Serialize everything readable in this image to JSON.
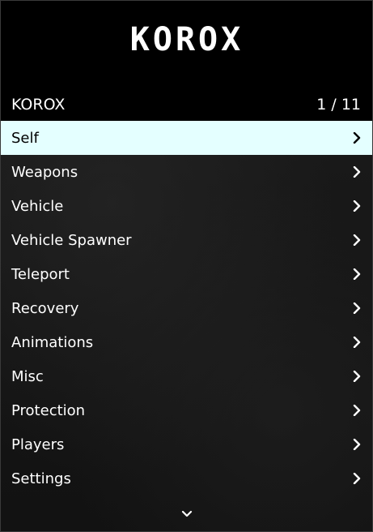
{
  "header": {
    "logo_text": "KOROX"
  },
  "subheader": {
    "title": "KOROX",
    "page_indicator": "1 / 11"
  },
  "menu": {
    "selected_index": 0,
    "items": [
      {
        "label": "Self",
        "icon": "chevron-right-icon"
      },
      {
        "label": "Weapons",
        "icon": "chevron-right-icon"
      },
      {
        "label": "Vehicle",
        "icon": "chevron-right-icon"
      },
      {
        "label": "Vehicle Spawner",
        "icon": "chevron-right-icon"
      },
      {
        "label": "Teleport",
        "icon": "chevron-right-icon"
      },
      {
        "label": "Recovery",
        "icon": "chevron-right-icon"
      },
      {
        "label": "Animations",
        "icon": "chevron-right-icon"
      },
      {
        "label": "Misc",
        "icon": "chevron-right-icon"
      },
      {
        "label": "Protection",
        "icon": "chevron-right-icon"
      },
      {
        "label": "Players",
        "icon": "chevron-right-icon"
      },
      {
        "label": "Settings",
        "icon": "chevron-right-icon"
      }
    ]
  },
  "footer": {
    "icon": "chevron-down-icon"
  },
  "colors": {
    "selected_bg": "#e4ffff",
    "selected_text": "#000000",
    "text": "#ffffff",
    "header_bg": "#000000"
  }
}
